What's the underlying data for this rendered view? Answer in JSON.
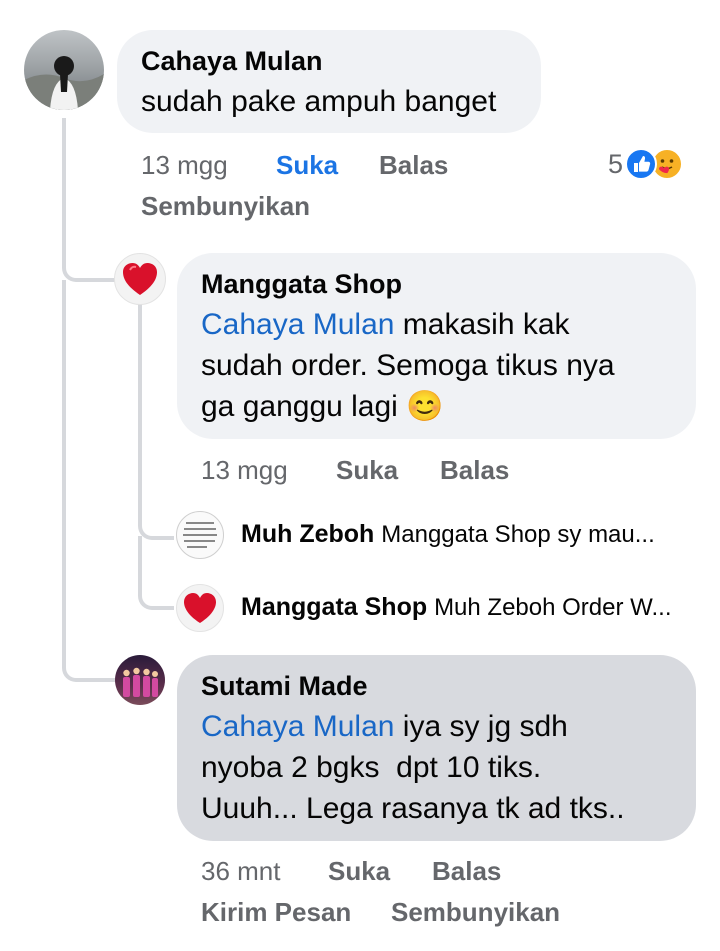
{
  "comments": [
    {
      "author": "Cahaya Mulan",
      "text": "sudah pake ampuh banget",
      "time": "13 mgg",
      "like_label": "Suka",
      "reply_label": "Balas",
      "hide_label": "Sembunyikan",
      "reaction_count": "5",
      "reaction_icons": [
        "like-icon",
        "care-icon"
      ]
    },
    {
      "author": "Manggata Shop",
      "mention": "Cahaya Mulan",
      "text_lines": [
        " makasih kak",
        "sudah order. Semoga tikus nya",
        "ga ganggu lagi"
      ],
      "emoji": "😊",
      "time": "13 mgg",
      "like_label": "Suka",
      "reply_label": "Balas"
    },
    {
      "author": "Sutami Made",
      "mention": "Cahaya Mulan",
      "text_lines": [
        " iya sy jg sdh",
        "nyoba 2 bgks  dpt 10 tiks.",
        "Uuuh... Lega rasanya tk ad tks.."
      ],
      "time": "36 mnt",
      "like_label": "Suka",
      "reply_label": "Balas",
      "message_label": "Kirim Pesan",
      "hide_label": "Sembunyikan"
    }
  ],
  "collapsed_replies": [
    {
      "author": "Muh Zeboh",
      "snippet": "Manggata Shop sy mau..."
    },
    {
      "author": "Manggata Shop",
      "snippet": "Muh Zeboh Order W..."
    }
  ],
  "colors": {
    "bubble": "#f0f2f5",
    "bubble_highlight": "#d8dadf",
    "mention": "#1967c6",
    "liked": "#1b74e4",
    "meta": "#65676b"
  }
}
